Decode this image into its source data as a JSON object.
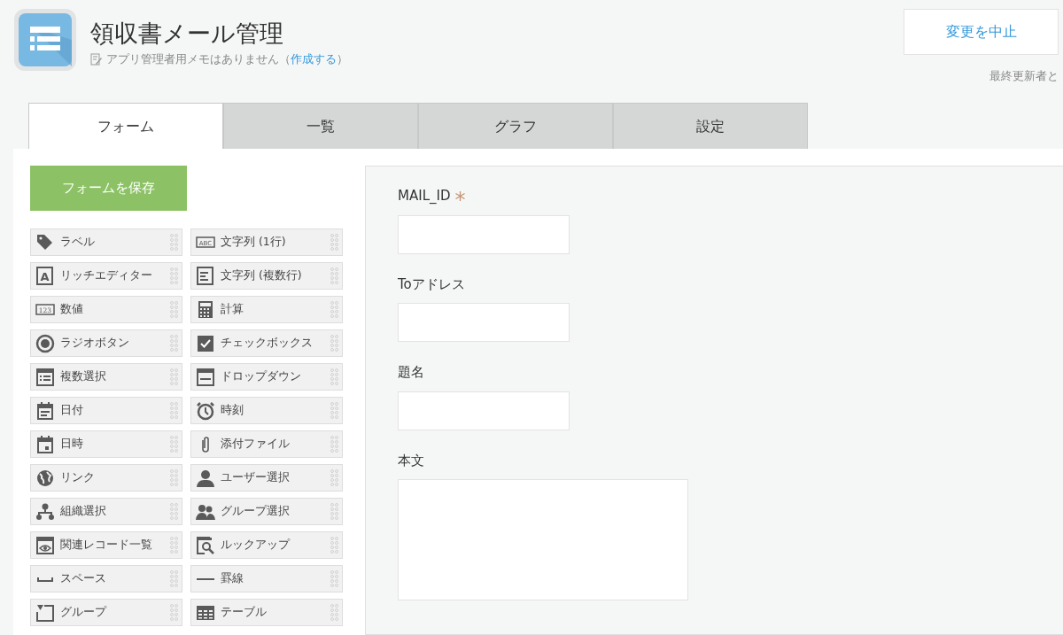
{
  "app": {
    "title": "領収書メール管理",
    "memo": "アプリ管理者用メモはありません（",
    "memo_link": "作成する",
    "memo_end": "）"
  },
  "actions": {
    "cancel": "変更を中止",
    "last_updated": "最終更新者と"
  },
  "tabs": [
    {
      "label": "フォーム",
      "selected": true
    },
    {
      "label": "一覧",
      "selected": false
    },
    {
      "label": "グラフ",
      "selected": false
    },
    {
      "label": "設定",
      "selected": false
    }
  ],
  "save_button": "フォームを保存",
  "palette": [
    {
      "label": "ラベル",
      "kind": "tag"
    },
    {
      "label": "文字列 (1行)",
      "kind": "abc",
      "icon_text": "ABC"
    },
    {
      "label": "リッチエディター",
      "kind": "rich",
      "icon_text": "A"
    },
    {
      "label": "文字列 (複数行)",
      "kind": "multiline"
    },
    {
      "label": "数値",
      "kind": "number",
      "icon_text": "123"
    },
    {
      "label": "計算",
      "kind": "calc"
    },
    {
      "label": "ラジオボタン",
      "kind": "radio"
    },
    {
      "label": "チェックボックス",
      "kind": "check"
    },
    {
      "label": "複数選択",
      "kind": "multiselect"
    },
    {
      "label": "ドロップダウン",
      "kind": "dropdown"
    },
    {
      "label": "日付",
      "kind": "date"
    },
    {
      "label": "時刻",
      "kind": "clock"
    },
    {
      "label": "日時",
      "kind": "datetime"
    },
    {
      "label": "添付ファイル",
      "kind": "clip"
    },
    {
      "label": "リンク",
      "kind": "globe"
    },
    {
      "label": "ユーザー選択",
      "kind": "user"
    },
    {
      "label": "組織選択",
      "kind": "org"
    },
    {
      "label": "グループ選択",
      "kind": "users"
    },
    {
      "label": "関連レコード一覧",
      "kind": "eye"
    },
    {
      "label": "ルックアップ",
      "kind": "lookup"
    },
    {
      "label": "スペース",
      "kind": "space"
    },
    {
      "label": "罫線",
      "kind": "line"
    },
    {
      "label": "グループ",
      "kind": "group"
    },
    {
      "label": "テーブル",
      "kind": "table"
    }
  ],
  "fields": [
    {
      "label": "MAIL_ID",
      "required": true,
      "kind": "text"
    },
    {
      "label": "Toアドレス",
      "required": false,
      "kind": "text"
    },
    {
      "label": "題名",
      "required": false,
      "kind": "text"
    },
    {
      "label": "本文",
      "required": false,
      "kind": "textarea"
    }
  ]
}
